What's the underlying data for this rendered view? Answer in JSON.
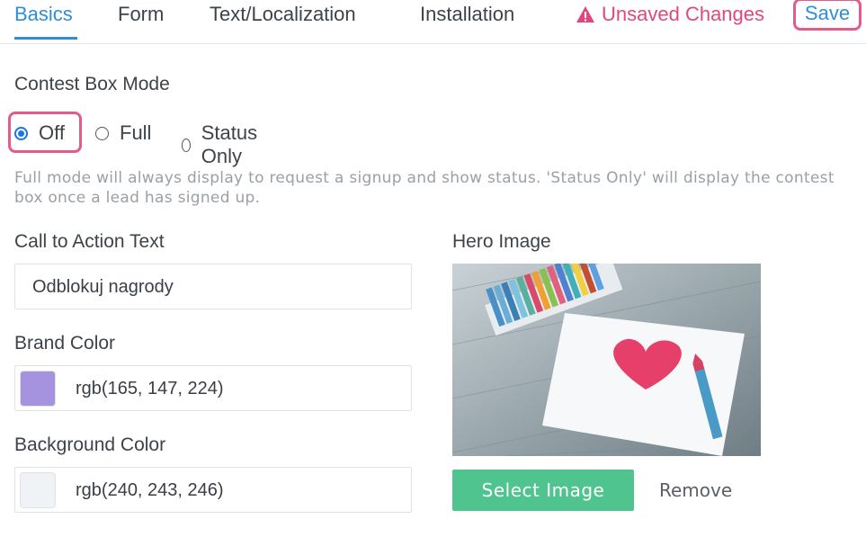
{
  "tabs": [
    {
      "label": "Basics",
      "active": true
    },
    {
      "label": "Form",
      "active": false
    },
    {
      "label": "Text/Localization",
      "active": false
    },
    {
      "label": "Installation",
      "active": false
    }
  ],
  "header": {
    "unsaved_label": "Unsaved Changes",
    "unsaved_icon": "warning-icon",
    "save_label": "Save"
  },
  "contest_box": {
    "label": "Contest Box Mode",
    "options": [
      {
        "label": "Off",
        "checked": true
      },
      {
        "label": "Full",
        "checked": false
      },
      {
        "label": "Status Only",
        "checked": false
      }
    ],
    "help_text": "Full mode will always display to request a signup and show status. 'Status Only' will display the contest box once a lead has signed up."
  },
  "cta": {
    "label": "Call to Action Text",
    "value": "Odblokuj nagrody"
  },
  "brand_color": {
    "label": "Brand Color",
    "value": "rgb(165, 147, 224)",
    "swatch": "#a593e0"
  },
  "background_color": {
    "label": "Background Color",
    "value": "rgb(240, 243, 246)",
    "swatch": "#f0f3f6"
  },
  "hero": {
    "label": "Hero Image",
    "select_label": "Select Image",
    "remove_label": "Remove"
  },
  "colors": {
    "accent": "#2f8fd6",
    "alert": "#e1477f",
    "highlight": "#e45b8a",
    "button_green": "#4fc48f"
  }
}
